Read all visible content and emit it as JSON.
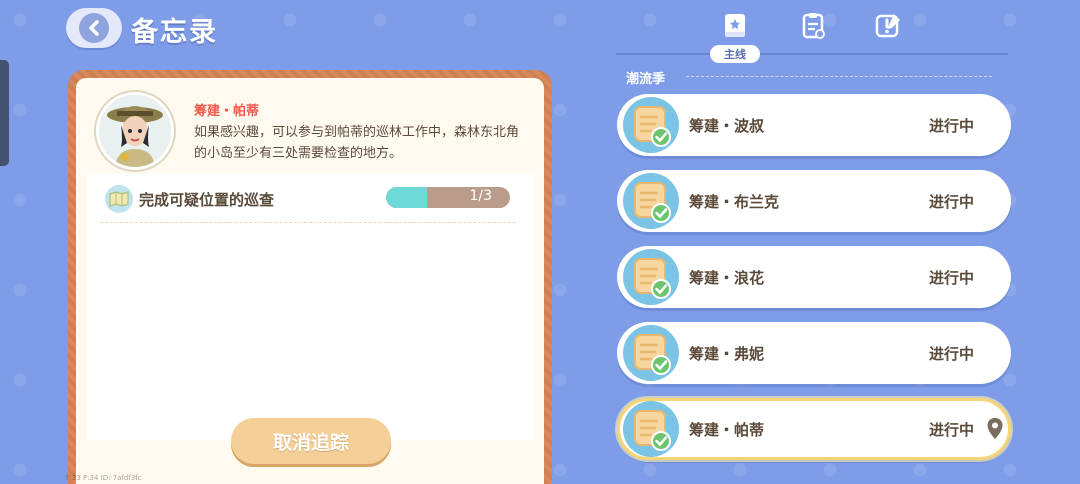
{
  "header": {
    "title": "备忘录"
  },
  "detail": {
    "npc_name": "筹建・帕蒂",
    "description": "如果感兴趣，可以参与到帕蒂的巡林工作中，森林东北角的小岛至少有三处需要检查的地方。",
    "task": {
      "text": "完成可疑位置的巡查",
      "progress_text": "1/3",
      "progress_fraction": 0.333
    },
    "untrack_button": "取消追踪",
    "debug_text": "F:23   P:34   ID: 7afdf3fc"
  },
  "tabs": {
    "active_label": "主线",
    "icons": [
      "book-icon",
      "clipboard-icon",
      "quest-note-icon"
    ]
  },
  "section": {
    "label": "潮流季"
  },
  "quests": [
    {
      "name": "筹建・波叔",
      "status": "进行中",
      "selected": false
    },
    {
      "name": "筹建・布兰克",
      "status": "进行中",
      "selected": false
    },
    {
      "name": "筹建・浪花",
      "status": "进行中",
      "selected": false
    },
    {
      "name": "筹建・弗妮",
      "status": "进行中",
      "selected": false
    },
    {
      "name": "筹建・帕蒂",
      "status": "进行中",
      "selected": true
    }
  ],
  "colors": {
    "background": "#7f9ce8",
    "npc_name": "#f05a4c",
    "progress_fill": "#6fd9d8",
    "button": "#f5cf98",
    "selected_border": "#f5d577"
  }
}
